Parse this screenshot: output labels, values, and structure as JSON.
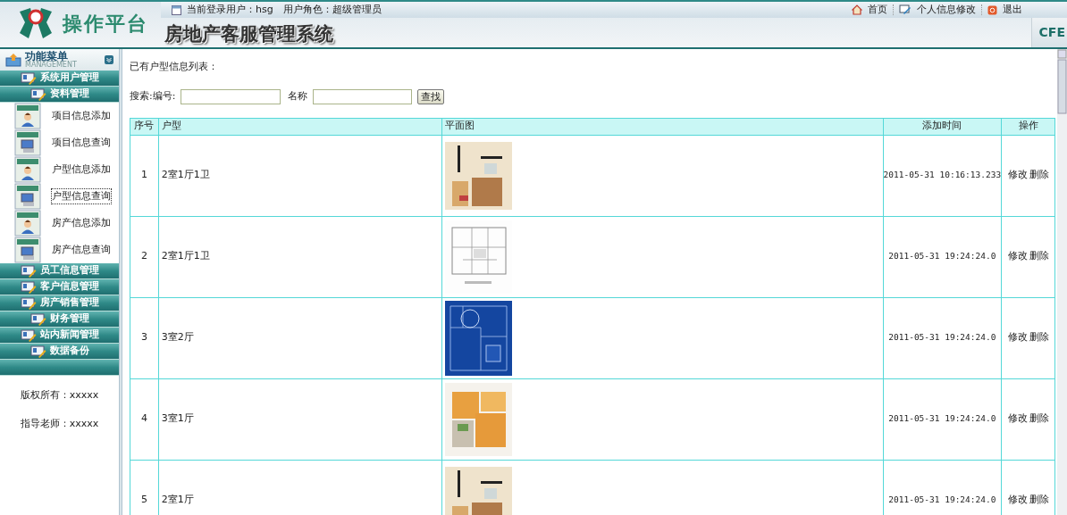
{
  "header": {
    "brand": "操作平台",
    "system_title": "房地产客服管理系统",
    "user_info": "当前登录用户：hsg　用户角色：超级管理员",
    "links": [
      {
        "kind": "home",
        "label": "首页"
      },
      {
        "kind": "profile",
        "label": "个人信息修改"
      },
      {
        "kind": "logout",
        "label": "退出"
      }
    ],
    "corner_tab": "CFE"
  },
  "sidebar": {
    "title": "功能菜单",
    "subtitle": "MANAGEMENT",
    "groups": [
      {
        "label": "系统用户管理"
      },
      {
        "label": "资料管理",
        "children": [
          {
            "label": "项目信息添加",
            "kind": "add",
            "selected": false
          },
          {
            "label": "项目信息查询",
            "kind": "query",
            "selected": false
          },
          {
            "label": "户型信息添加",
            "kind": "add",
            "selected": false
          },
          {
            "label": "户型信息查询",
            "kind": "query",
            "selected": true
          },
          {
            "label": "房产信息添加",
            "kind": "add",
            "selected": false
          },
          {
            "label": "房产信息查询",
            "kind": "query",
            "selected": false
          }
        ]
      },
      {
        "label": "员工信息管理"
      },
      {
        "label": "客户信息管理"
      },
      {
        "label": "房产销售管理"
      },
      {
        "label": "财务管理"
      },
      {
        "label": "站内新闻管理"
      },
      {
        "label": "数据备份"
      }
    ],
    "footer": [
      "版权所有：xxxxx",
      "指导老师：xxxxx"
    ]
  },
  "main": {
    "heading": "已有户型信息列表：",
    "search": {
      "label": "搜索:编号:",
      "name_label": "名称",
      "button": "查找"
    },
    "table": {
      "columns": [
        "序号",
        "户型",
        "平面图",
        "添加时间",
        "操作"
      ],
      "rows": [
        {
          "no": "1",
          "type": "2室1厅1卫",
          "plan": {
            "kind": "picture"
          },
          "time": "2011-05-31 10:16:13.233",
          "actions": [
            "修改",
            "删除"
          ]
        },
        {
          "no": "2",
          "type": "2室1厅1卫",
          "plan": {
            "kind": "picture"
          },
          "time": "2011-05-31 19:24:24.0",
          "actions": [
            "修改",
            "删除"
          ]
        },
        {
          "no": "3",
          "type": "3室2厅",
          "plan": {
            "kind": "picture"
          },
          "time": "2011-05-31 19:24:24.0",
          "actions": [
            "修改",
            "删除"
          ]
        },
        {
          "no": "4",
          "type": "3室1厅",
          "plan": {
            "kind": "picture"
          },
          "time": "2011-05-31 19:24:24.0",
          "actions": [
            "修改",
            "删除"
          ]
        },
        {
          "no": "5",
          "type": "2室1厅",
          "plan": {
            "kind": "picture"
          },
          "time": "2011-05-31 19:24:24.0",
          "actions": [
            "修改",
            "删除"
          ]
        }
      ]
    }
  }
}
